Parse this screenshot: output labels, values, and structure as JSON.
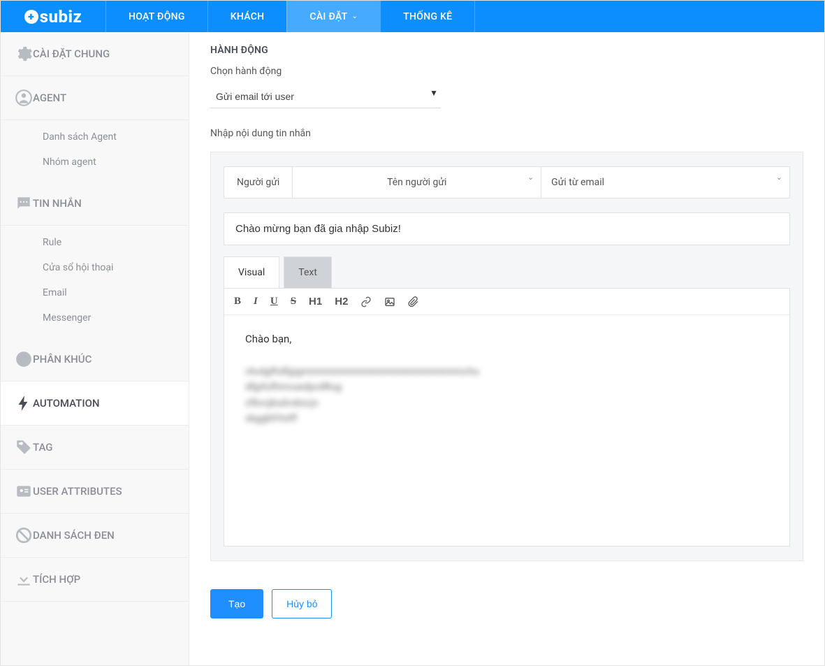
{
  "brand": "subiz",
  "topnav": {
    "items": [
      {
        "label": "HOẠT ĐỘNG",
        "active": false
      },
      {
        "label": "KHÁCH",
        "active": false
      },
      {
        "label": "CÀI ĐẶT",
        "active": true,
        "hasDropdown": true
      },
      {
        "label": "THỐNG KÊ",
        "active": false
      }
    ]
  },
  "sidebar": {
    "groups": [
      {
        "label": "CÀI ĐẶT CHUNG",
        "icon": "gear",
        "subs": []
      },
      {
        "label": "AGENT",
        "icon": "user",
        "subs": [
          "Danh sách Agent",
          "Nhóm agent"
        ]
      },
      {
        "label": "TIN NHẮN",
        "icon": "chat",
        "subs": [
          "Rule",
          "Cửa sổ hội thoại",
          "Email",
          "Messenger"
        ]
      },
      {
        "label": "PHÂN KHÚC",
        "icon": "pie",
        "subs": []
      },
      {
        "label": "AUTOMATION",
        "icon": "bolt",
        "subs": [],
        "active": true
      },
      {
        "label": "TAG",
        "icon": "tag",
        "subs": []
      },
      {
        "label": "USER ATTRIBUTES",
        "icon": "idcard",
        "subs": []
      },
      {
        "label": "DANH SÁCH ĐEN",
        "icon": "ban",
        "subs": []
      },
      {
        "label": "TÍCH HỢP",
        "icon": "download",
        "subs": []
      }
    ]
  },
  "content": {
    "section_title": "HÀNH ĐỘNG",
    "action_label": "Chọn hành động",
    "action_value": "Gửi email tới user",
    "message_label": "Nhập nội dung tin nhắn",
    "sender_label": "Người gửi",
    "sender_name_placeholder": "Tên người gửi",
    "sender_email_placeholder": "Gửi từ email",
    "subject_value": "Chào mừng bạn đã gia nhập Subiz!",
    "tabs": {
      "visual": "Visual",
      "text": "Text"
    },
    "toolbar": {
      "h1": "H1",
      "h2": "H2"
    },
    "body_greeting": "Chào bạn,",
    "body_lines": [
      "rAvdgfhdfgignnnnnnnnnnnnnnnnnnnnnnnnnnnnnnchu",
      "dfjpfufhmvuedpvdRug",
      "zfbvcjksdvskscjv",
      "skggbfrfutff"
    ],
    "create_button": "Tạo",
    "cancel_button": "Hủy bỏ"
  }
}
